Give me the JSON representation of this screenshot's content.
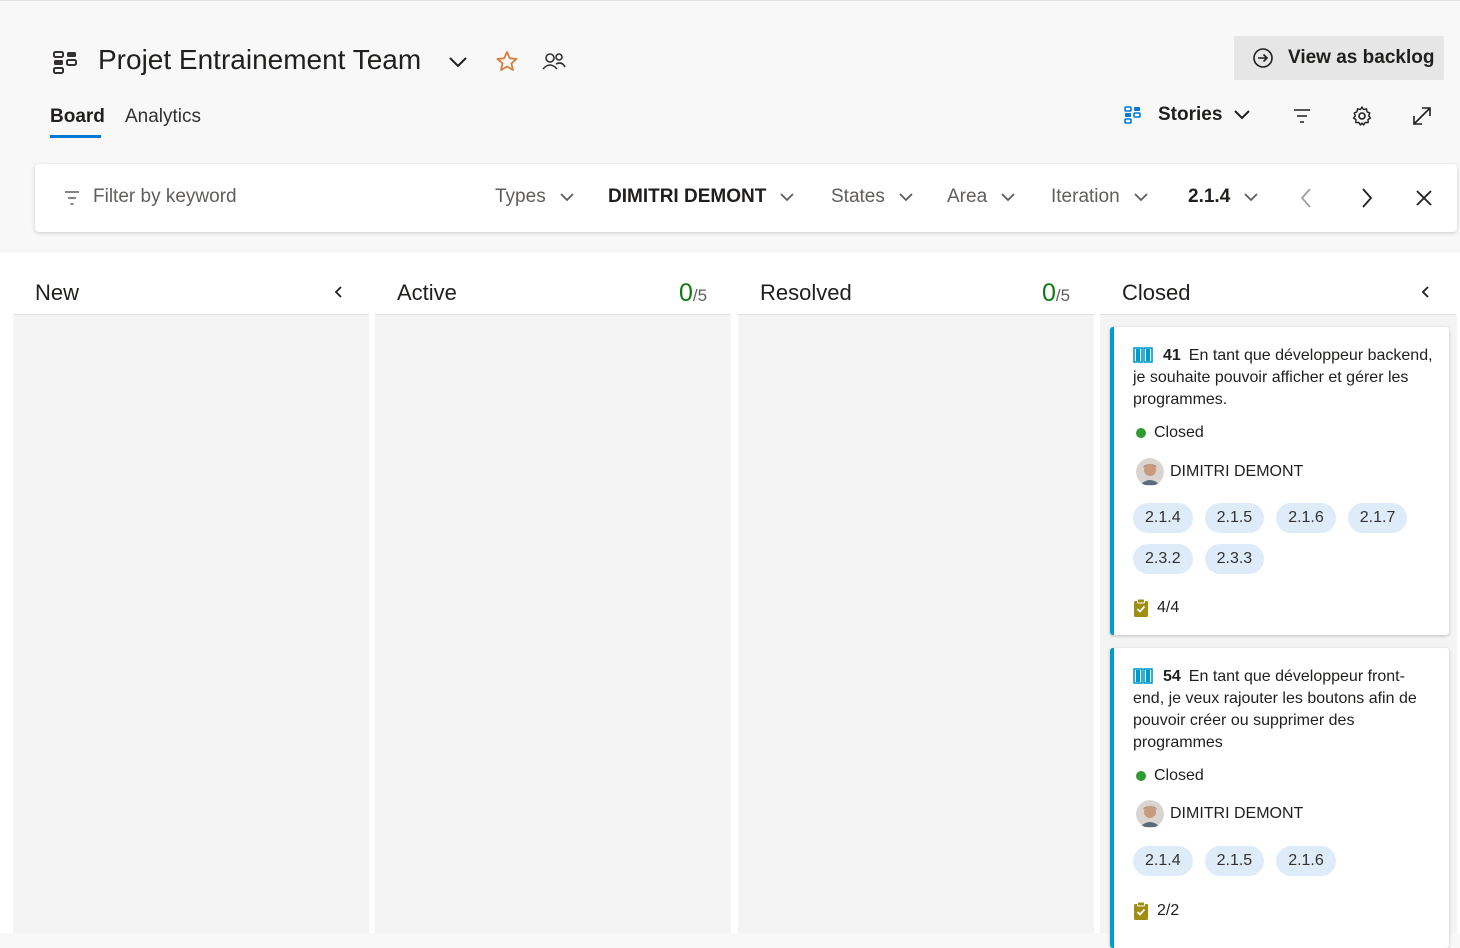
{
  "header": {
    "title": "Projet Entrainement Team",
    "view_as_backlog": "View as backlog",
    "tabs": [
      {
        "label": "Board",
        "active": true
      },
      {
        "label": "Analytics",
        "active": false
      }
    ],
    "backlog_level": "Stories",
    "icons": [
      "team-icon",
      "chevron-down-icon",
      "star-icon",
      "people-icon",
      "arrow-right-circle-icon",
      "backlog-icon",
      "filter-icon",
      "gear-icon",
      "expand-icon"
    ]
  },
  "filter_bar": {
    "keyword_placeholder": "Filter by keyword",
    "dropdowns": {
      "types": "Types",
      "assigned": "DIMITRI DEMONT",
      "states": "States",
      "area": "Area",
      "iteration": "Iteration",
      "iteration_value": "2.1.4"
    }
  },
  "columns": [
    {
      "name": "New"
    },
    {
      "name": "Active",
      "count": "0",
      "limit": "/5"
    },
    {
      "name": "Resolved",
      "count": "0",
      "limit": "/5"
    },
    {
      "name": "Closed"
    }
  ],
  "cards": [
    {
      "id": "41",
      "title": "En tant que développeur backend, je souhaite pouvoir afficher et gérer les programmes.",
      "state": "Closed",
      "assignee": "DIMITRI DEMONT",
      "tags": [
        "2.1.4",
        "2.1.5",
        "2.1.6",
        "2.1.7",
        "2.3.2",
        "2.3.3"
      ],
      "checklist": "4/4"
    },
    {
      "id": "54",
      "title": "En tant que développeur front-end, je veux rajouter les boutons afin de pouvoir créer ou supprimer des programmes",
      "state": "Closed",
      "assignee": "DIMITRI DEMONT",
      "tags": [
        "2.1.4",
        "2.1.5",
        "2.1.6"
      ],
      "checklist": "2/2"
    }
  ],
  "colors": {
    "accent": "#0078d4",
    "story_border": "#009ccc",
    "closed_dot": "#339933",
    "count_green": "#107c10",
    "tag_bg": "#deecf9",
    "star": "#d67f3c"
  }
}
